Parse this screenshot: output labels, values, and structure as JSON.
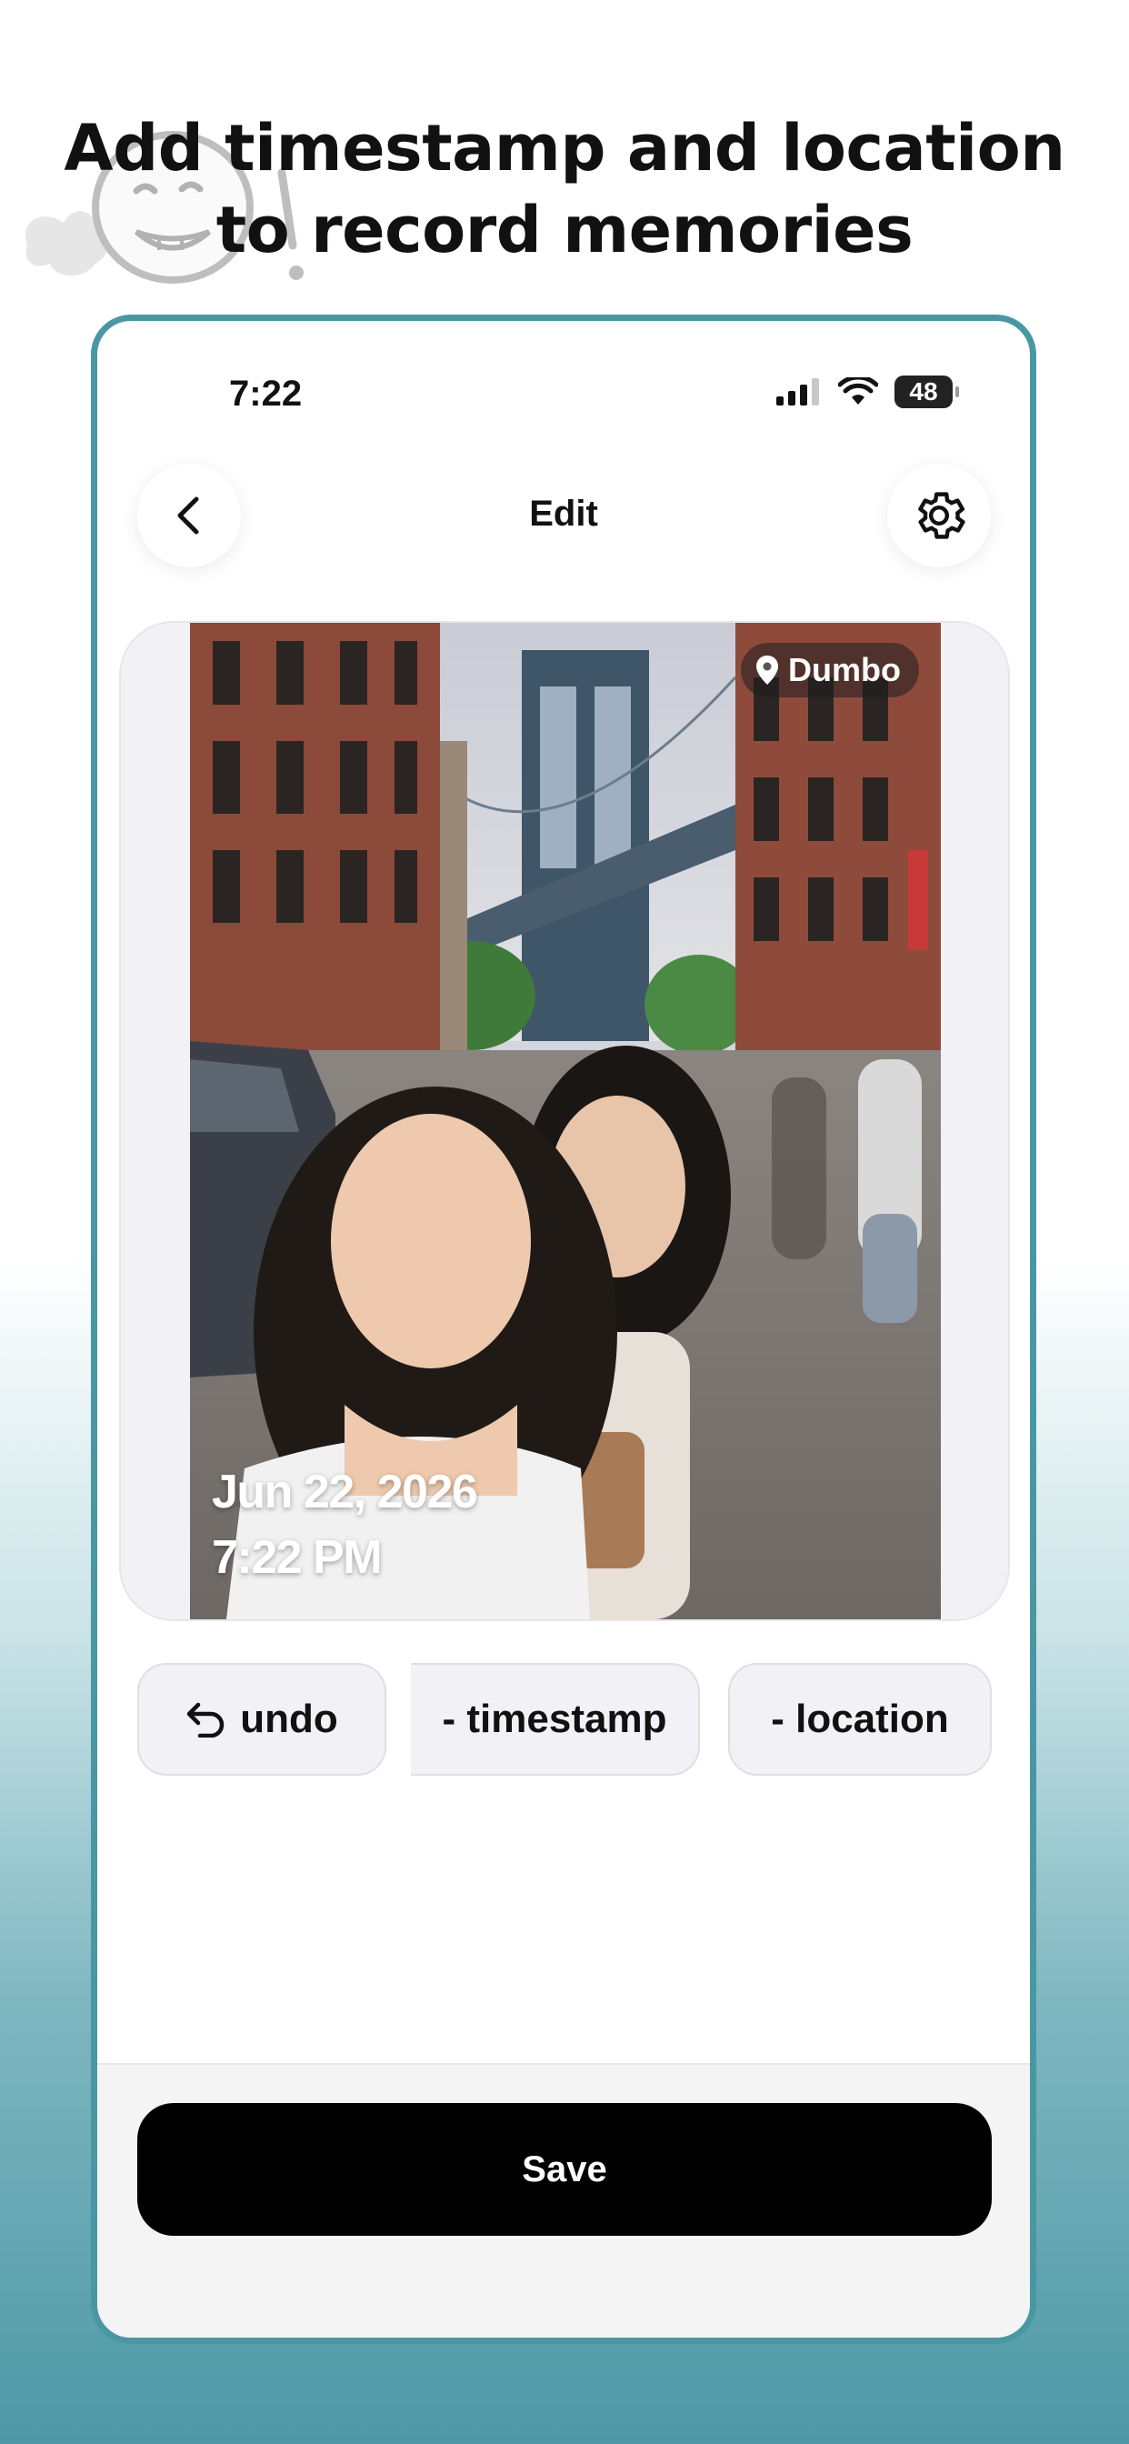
{
  "promo": {
    "headline_line1": "Add timestamp and location",
    "headline_line2": "to record memories"
  },
  "status_bar": {
    "time": "7:22",
    "battery": "48"
  },
  "header": {
    "title": "Edit",
    "back_icon": "chevron-left-icon",
    "settings_icon": "gear-icon"
  },
  "photo": {
    "location_label": "Dumbo",
    "date_label": "Jun 22, 2026",
    "time_label": "7:22 PM"
  },
  "actions": {
    "undo_label": "undo",
    "timestamp_label": "- timestamp",
    "location_label": "- location"
  },
  "footer": {
    "save_label": "Save"
  },
  "colors": {
    "accent_border": "#4a97a4",
    "save_button": "#000000",
    "chip_background": "#f1f1f6"
  }
}
